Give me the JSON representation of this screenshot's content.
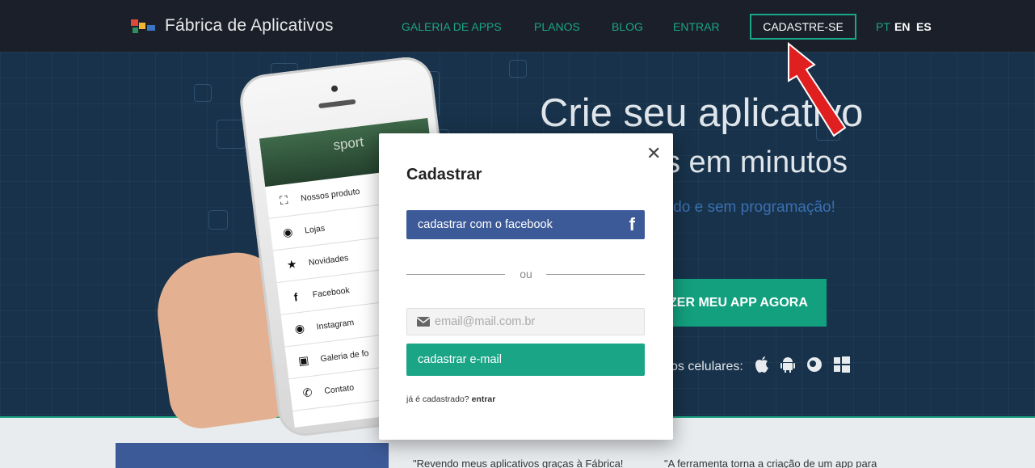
{
  "nav": {
    "brand": "Fábrica de Aplicativos",
    "links": [
      "GALERIA DE APPS",
      "PLANOS",
      "BLOG",
      "ENTRAR"
    ],
    "cta": "CADASTRE-SE",
    "langs": [
      "PT",
      "EN",
      "ES"
    ],
    "colors": {
      "bg": "#1b1f2a",
      "link": "#1aa586"
    }
  },
  "hero": {
    "title": "Crie seu aplicativo",
    "subtitle": "s em minutos",
    "tagline": "ido e sem programação!",
    "button": "ZER MEU APP AGORA",
    "platforms_label": "os celulares:",
    "platform_icons": [
      "apple-icon",
      "android-icon",
      "blackberry-icon",
      "windows-icon"
    ]
  },
  "phone": {
    "header_text": "sport",
    "menu": [
      {
        "icon": "basket-icon",
        "label": "Nossos produto"
      },
      {
        "icon": "map-pin-icon",
        "label": "Lojas"
      },
      {
        "icon": "star-icon",
        "label": "Novidades"
      },
      {
        "icon": "facebook-icon",
        "label": "Facebook"
      },
      {
        "icon": "instagram-icon",
        "label": "Instagram"
      },
      {
        "icon": "camera-icon",
        "label": "Galeria de fo"
      },
      {
        "icon": "phone-icon",
        "label": "Contato"
      }
    ]
  },
  "modal": {
    "title": "Cadastrar",
    "close": "✕",
    "facebook_button": "cadastrar com o facebook",
    "facebook_icon": "f",
    "divider": "ou",
    "email_placeholder": "email@mail.com.br",
    "email_button": "cadastrar e-mail",
    "already": "já é cadastrado?",
    "login": "entrar"
  },
  "bottom": {
    "quote1": "\"Revendo meus aplicativos graças à Fábrica!",
    "quote2": "\"A ferramenta torna a criação de um app para"
  }
}
